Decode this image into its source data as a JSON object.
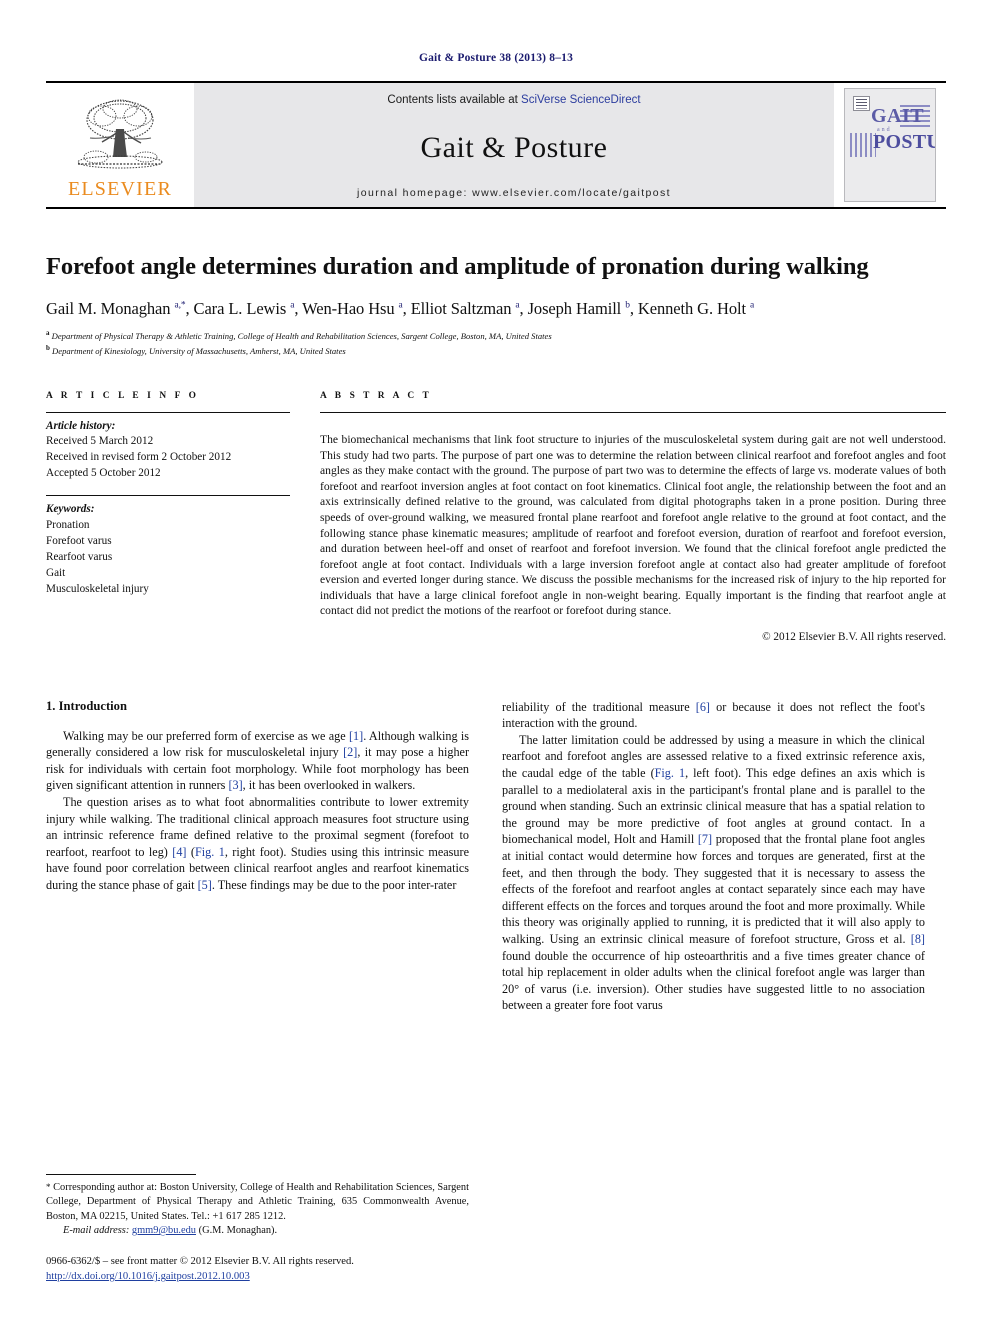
{
  "running_head": "Gait & Posture 38 (2013) 8–13",
  "masthead": {
    "publisher_name": "ELSEVIER",
    "contents_prefix": "Contents lists available at ",
    "contents_link": "SciVerse ScienceDirect",
    "journal_title": "Gait & Posture",
    "homepage": "journal homepage: www.elsevier.com/locate/gaitpost",
    "cover": {
      "line1": "GAIT",
      "line2": "and",
      "line3": "POSTURE"
    }
  },
  "article": {
    "title": "Forefoot angle determines duration and amplitude of pronation during walking",
    "authors": "Gail M. Monaghan <sup>a,*</sup>, Cara L. Lewis <sup>a</sup>, Wen-Hao Hsu <sup>a</sup>, Elliot Saltzman <sup>a</sup>, Joseph Hamill <sup>b</sup>, Kenneth G. Holt <sup>a</sup>",
    "affiliation_a": "<sup>a</sup> Department of Physical Therapy &amp; Athletic Training, College of Health and Rehabilitation Sciences, Sargent College, Boston, MA, United States",
    "affiliation_b": "<sup>b</sup> Department of Kinesiology, University of Massachusetts, Amherst, MA, United States"
  },
  "info": {
    "heading": "A R T I C L E  I N F O",
    "history_label": "Article history:",
    "history": [
      "Received 5 March 2012",
      "Received in revised form 2 October 2012",
      "Accepted 5 October 2012"
    ],
    "keywords_label": "Keywords:",
    "keywords": [
      "Pronation",
      "Forefoot varus",
      "Rearfoot varus",
      "Gait",
      "Musculoskeletal injury"
    ]
  },
  "abstract": {
    "heading": "A B S T R A C T",
    "text": "The biomechanical mechanisms that link foot structure to injuries of the musculoskeletal system during gait are not well understood. This study had two parts. The purpose of part one was to determine the relation between clinical rearfoot and forefoot angles and foot angles as they make contact with the ground. The purpose of part two was to determine the effects of large vs. moderate values of both forefoot and rearfoot inversion angles at foot contact on foot kinematics. Clinical foot angle, the relationship between the foot and an axis extrinsically defined relative to the ground, was calculated from digital photographs taken in a prone position. During three speeds of over-ground walking, we measured frontal plane rearfoot and forefoot angle relative to the ground at foot contact, and the following stance phase kinematic measures; amplitude of rearfoot and forefoot eversion, duration of rearfoot and forefoot eversion, and duration between heel-off and onset of rearfoot and forefoot inversion. We found that the clinical forefoot angle predicted the forefoot angle at foot contact. Individuals with a large inversion forefoot angle at contact also had greater amplitude of forefoot eversion and everted longer during stance. We discuss the possible mechanisms for the increased risk of injury to the hip reported for individuals that have a large clinical forefoot angle in non-weight bearing. Equally important is the finding that rearfoot angle at contact did not predict the motions of the rearfoot or forefoot during stance.",
    "copyright": "© 2012 Elsevier B.V. All rights reserved."
  },
  "introduction": {
    "heading": "1. Introduction",
    "left_paragraphs": [
      "Walking may be our preferred form of exercise as we age <span class=\"ref\">[1]</span>. Although walking is generally considered a low risk for musculoskeletal injury <span class=\"ref\">[2]</span>, it may pose a higher risk for individuals with certain foot morphology. While foot morphology has been given significant attention in runners <span class=\"ref\">[3]</span>, it has been overlooked in walkers.",
      "The question arises as to what foot abnormalities contribute to lower extremity injury while walking. The traditional clinical approach measures foot structure using an intrinsic reference frame defined relative to the proximal segment (forefoot to rearfoot, rearfoot to leg) <span class=\"ref\">[4]</span> (<span class=\"figref\">Fig. 1</span>, right foot). Studies using this intrinsic measure have found poor correlation between clinical rearfoot angles and rearfoot kinematics during the stance phase of gait <span class=\"ref\">[5]</span>. These findings may be due to the poor inter-rater"
    ],
    "right_paragraphs": [
      "reliability of the traditional measure <span class=\"ref\">[6]</span> or because it does not reflect the foot's interaction with the ground.",
      "The latter limitation could be addressed by using a measure in which the clinical rearfoot and forefoot angles are assessed relative to a fixed extrinsic reference axis, the caudal edge of the table (<span class=\"figref\">Fig. 1</span>, left foot). This edge defines an axis which is parallel to a mediolateral axis in the participant's frontal plane and is parallel to the ground when standing. Such an extrinsic clinical measure that has a spatial relation to the ground may be more predictive of foot angles at ground contact. In a biomechanical model, Holt and Hamill <span class=\"ref\">[7]</span> proposed that the frontal plane foot angles at initial contact would determine how forces and torques are generated, first at the feet, and then through the body. They suggested that it is necessary to assess the effects of the forefoot and rearfoot angles at contact separately since each may have different effects on the forces and torques around the foot and more proximally. While this theory was originally applied to running, it is predicted that it will also apply to walking. Using an extrinsic clinical measure of forefoot structure, Gross et al. <span class=\"ref\">[8]</span> found double the occurrence of hip osteoarthritis and a five times greater chance of total hip replacement in older adults when the clinical forefoot angle was larger than 20° of varus (i.e. inversion). Other studies have suggested little to no association between a greater fore foot varus"
    ]
  },
  "footnotes": {
    "corresponding": "<span class=\"star\">*</span>  Corresponding author at: Boston University, College of Health and Rehabilitation Sciences, Sargent College, Department of Physical Therapy and Athletic Training, 635 Commonwealth Avenue, Boston, MA 02215, United States. Tel.: +1 617 285 1212.",
    "email_label": "E-mail address:",
    "email": "gmm9@bu.edu",
    "email_suffix": "(G.M. Monaghan).",
    "issn_line": "0966-6362/$ – see front matter © 2012 Elsevier B.V. All rights reserved.",
    "doi": "http://dx.doi.org/10.1016/j.gaitpost.2012.10.003"
  },
  "colors": {
    "link": "#1f3fa0",
    "running_head": "#1a1a6e",
    "elsevier_orange": "#ea8b1f",
    "masthead_bg": "#e7e7e9",
    "cover_purple": "#5b5ba6"
  }
}
